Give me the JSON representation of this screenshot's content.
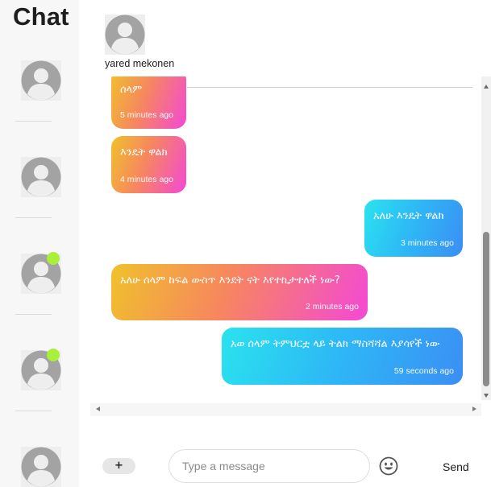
{
  "sidebar": {
    "title": "Chat",
    "contacts": [
      {
        "online": false
      },
      {
        "online": false
      },
      {
        "online": true
      },
      {
        "online": true
      },
      {
        "online": false
      }
    ]
  },
  "chat": {
    "contact_name": "yared mekonen",
    "messages": [
      {
        "direction": "in",
        "text": "ሰላም",
        "time": "5 minutes ago"
      },
      {
        "direction": "in",
        "text": "እንዴት ዋልክ",
        "time": "4 minutes ago"
      },
      {
        "direction": "out",
        "text": "አለሁ እንዴት ዋልክ",
        "time": "3 minutes ago"
      },
      {
        "direction": "in",
        "text": "አለሁ ሰላም ከፍል ውስጥ እንደት ናት እየተኪታተለች ነው?",
        "time": "2 minutes ago"
      },
      {
        "direction": "out",
        "text": "አወ ሰላም ትምህርቷ ላይ ትልክ ማስሻሻል እያሳየች ነው",
        "time": "59 seconds ago"
      }
    ]
  },
  "composer": {
    "attach_label": "+",
    "placeholder": "Type a message",
    "value": "",
    "emoji_icon": "smiley-face-icon",
    "send_label": "Send"
  },
  "colors": {
    "incoming_gradient": [
      "#f0c12c",
      "#f7865f",
      "#f349d5"
    ],
    "outgoing_gradient": [
      "#2ae3ee",
      "#2eb6f6",
      "#3b8ef3"
    ],
    "online_dot": "#a8f03a",
    "sidebar_bg": "#f7f7f7"
  }
}
